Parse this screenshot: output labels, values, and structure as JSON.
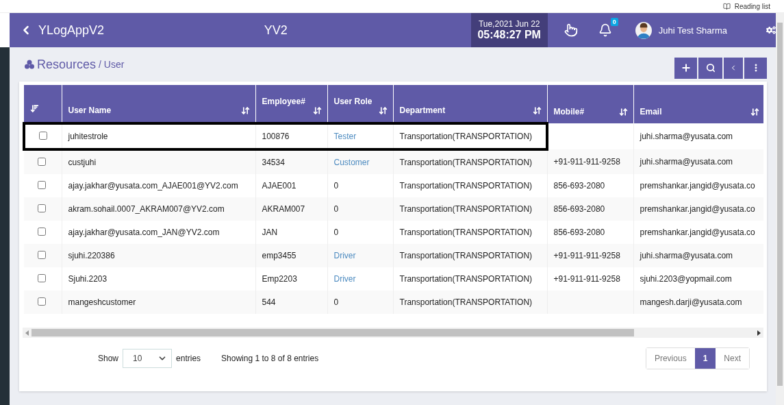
{
  "browser_bar": {
    "reading_list": "Reading list"
  },
  "header": {
    "app_title": "YLogAppV2",
    "center_title": "YV2",
    "date": "Tue,2021 Jun 22",
    "time": "05:48:27 PM",
    "notification_count": "0",
    "user_name": "Juhi Test Sharma"
  },
  "breadcrumb": {
    "section": "Resources",
    "separator": "/",
    "page": "User"
  },
  "table": {
    "columns": [
      {
        "label": "User Name"
      },
      {
        "label": "Employee#"
      },
      {
        "label": "User Role"
      },
      {
        "label": "Department"
      },
      {
        "label": "Mobile#"
      },
      {
        "label": "Email"
      }
    ],
    "rows": [
      {
        "checked": false,
        "highlighted": true,
        "cells": [
          "juhitestrole",
          "100876",
          "Tester",
          "Transportation(TRANSPORTATION)",
          "",
          "juhi.sharma@yusata.com"
        ],
        "role_is_link": true
      },
      {
        "checked": false,
        "highlighted": false,
        "cells": [
          "custjuhi",
          "34534",
          "Customer",
          "Transportation(TRANSPORTATION)",
          "+91-911-911-9258",
          "juhi.sharma@yusata.com"
        ],
        "role_is_link": true
      },
      {
        "checked": false,
        "highlighted": false,
        "cells": [
          "ajay.jakhar@yusata.com_AJAE001@YV2.com",
          "AJAE001",
          "0",
          "Transportation(TRANSPORTATION)",
          "856-693-2080",
          "premshankar.jangid@yusata.co"
        ],
        "role_is_link": false
      },
      {
        "checked": false,
        "highlighted": false,
        "cells": [
          "akram.sohail.0007_AKRAM007@YV2.com",
          "AKRAM007",
          "0",
          "Transportation(TRANSPORTATION)",
          "856-693-2080",
          "premshankar.jangid@yusata.co"
        ],
        "role_is_link": false
      },
      {
        "checked": false,
        "highlighted": false,
        "cells": [
          "ajay.jakhar@yusata.com_JAN@YV2.com",
          "JAN",
          "0",
          "Transportation(TRANSPORTATION)",
          "856-693-2080",
          "premshankar.jangid@yusata.co"
        ],
        "role_is_link": false
      },
      {
        "checked": false,
        "highlighted": false,
        "cells": [
          "sjuhi.220386",
          "emp3455",
          "Driver",
          "Transportation(TRANSPORTATION)",
          "+91-911-911-9258",
          "juhi.sharma@yusata.com"
        ],
        "role_is_link": true
      },
      {
        "checked": false,
        "highlighted": false,
        "cells": [
          "Sjuhi.2203",
          "Emp2203",
          "Driver",
          "Transportation(TRANSPORTATION)",
          "+91-911-911-9258",
          "sjuhi.2203@yopmail.com"
        ],
        "role_is_link": true
      },
      {
        "checked": false,
        "highlighted": false,
        "cells": [
          "mangeshcustomer",
          "544",
          "0",
          "Transportation(TRANSPORTATION)",
          "",
          "mangesh.darji@yusata.com"
        ],
        "role_is_link": false
      }
    ]
  },
  "footer": {
    "show_label": "Show",
    "page_size": "10",
    "entries_label": "entries",
    "info": "Showing 1 to 8 of 8 entries",
    "pagination": [
      {
        "label": "Previous",
        "selected": false
      },
      {
        "label": "1",
        "selected": true
      },
      {
        "label": "Next",
        "selected": false
      }
    ]
  }
}
